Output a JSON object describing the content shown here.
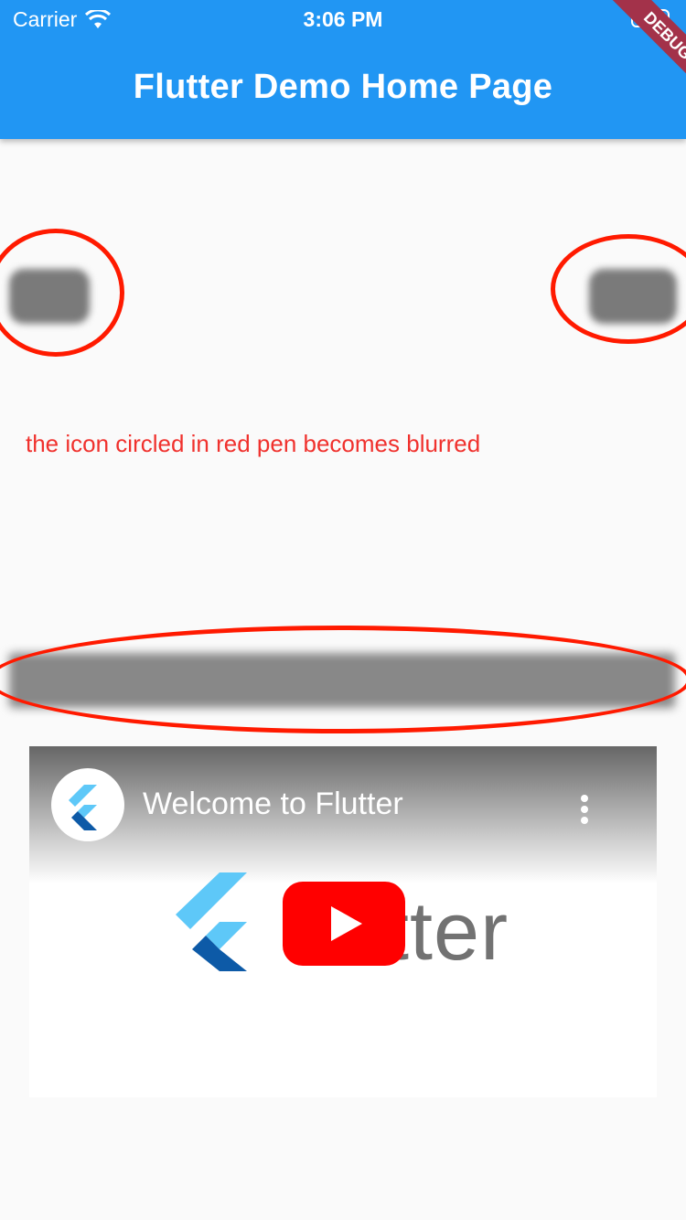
{
  "status_bar": {
    "carrier": "Carrier",
    "time": "3:06 PM"
  },
  "app_bar": {
    "title": "Flutter Demo Home Page",
    "debug_label": "DEBUG"
  },
  "note": {
    "text": "the icon circled in red pen becomes blurred"
  },
  "video": {
    "title": "Welcome to Flutter",
    "logo_text": "tter"
  },
  "colors": {
    "app_bar": "#2196f3",
    "annotation_red": "#ff1a00",
    "note_text": "#f0312d",
    "youtube_red": "#ff0000",
    "flutter_light": "#5ec8f8",
    "flutter_dark": "#0d5aa7"
  },
  "icons": [
    "wifi-icon",
    "battery-icon",
    "flutter-logo-icon",
    "more-vert-icon",
    "youtube-play-icon"
  ]
}
